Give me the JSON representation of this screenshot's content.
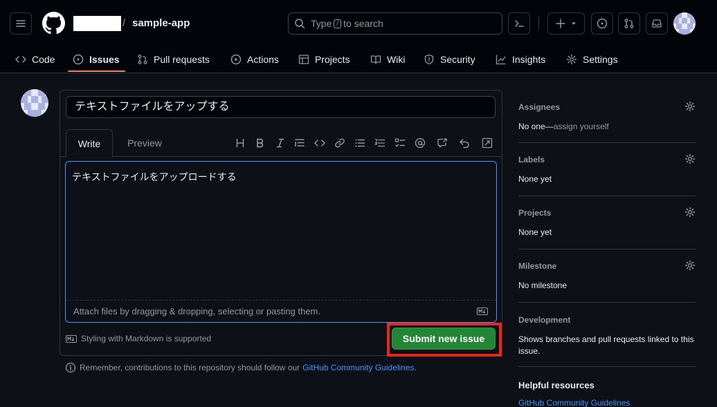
{
  "header": {
    "repo_name": "sample-app",
    "slash": "/",
    "search": {
      "prefix": "Type",
      "key": "/",
      "suffix": "to search"
    }
  },
  "nav": {
    "tabs": [
      {
        "label": "Code",
        "icon": "code-icon"
      },
      {
        "label": "Issues",
        "icon": "issue-opened-icon",
        "active": true
      },
      {
        "label": "Pull requests",
        "icon": "git-pull-request-icon"
      },
      {
        "label": "Actions",
        "icon": "play-icon"
      },
      {
        "label": "Projects",
        "icon": "table-icon"
      },
      {
        "label": "Wiki",
        "icon": "book-icon"
      },
      {
        "label": "Security",
        "icon": "shield-icon"
      },
      {
        "label": "Insights",
        "icon": "graph-icon"
      },
      {
        "label": "Settings",
        "icon": "gear-icon"
      }
    ]
  },
  "issue_form": {
    "title_value": "テキストファイルをアップする",
    "tabs": {
      "write": "Write",
      "preview": "Preview"
    },
    "body_value": "テキストファイルをアップロードする",
    "attach_hint": "Attach files by dragging & dropping, selecting or pasting them.",
    "markdown_note": "Styling with Markdown is supported",
    "submit_label": "Submit new issue",
    "remember_prefix": "Remember, contributions to this repository should follow our",
    "remember_link": "GitHub Community Guidelines",
    "remember_suffix": ".",
    "toolbar_icons": [
      "heading-icon",
      "bold-icon",
      "italic-icon",
      "quote-icon",
      "code-icon",
      "link-icon",
      "unordered-list-icon",
      "ordered-list-icon",
      "task-list-icon",
      "mention-icon",
      "cross-reference-icon",
      "undo-icon",
      "fullscreen-icon"
    ]
  },
  "sidebar": {
    "assignees": {
      "heading": "Assignees",
      "value": "No one—",
      "action": "assign yourself"
    },
    "labels": {
      "heading": "Labels",
      "value": "None yet"
    },
    "projects": {
      "heading": "Projects",
      "value": "None yet"
    },
    "milestone": {
      "heading": "Milestone",
      "value": "No milestone"
    },
    "development": {
      "heading": "Development",
      "value": "Shows branches and pull requests linked to this issue."
    },
    "helpful": {
      "heading": "Helpful resources",
      "link": "GitHub Community Guidelines"
    }
  },
  "colors": {
    "background": "#0d1117",
    "header_bg": "#010409",
    "border": "#30363d",
    "accent_link": "#4493f8",
    "submit_green": "#238636",
    "active_tab_underline": "#f78166",
    "highlight_red": "#e8261d"
  }
}
